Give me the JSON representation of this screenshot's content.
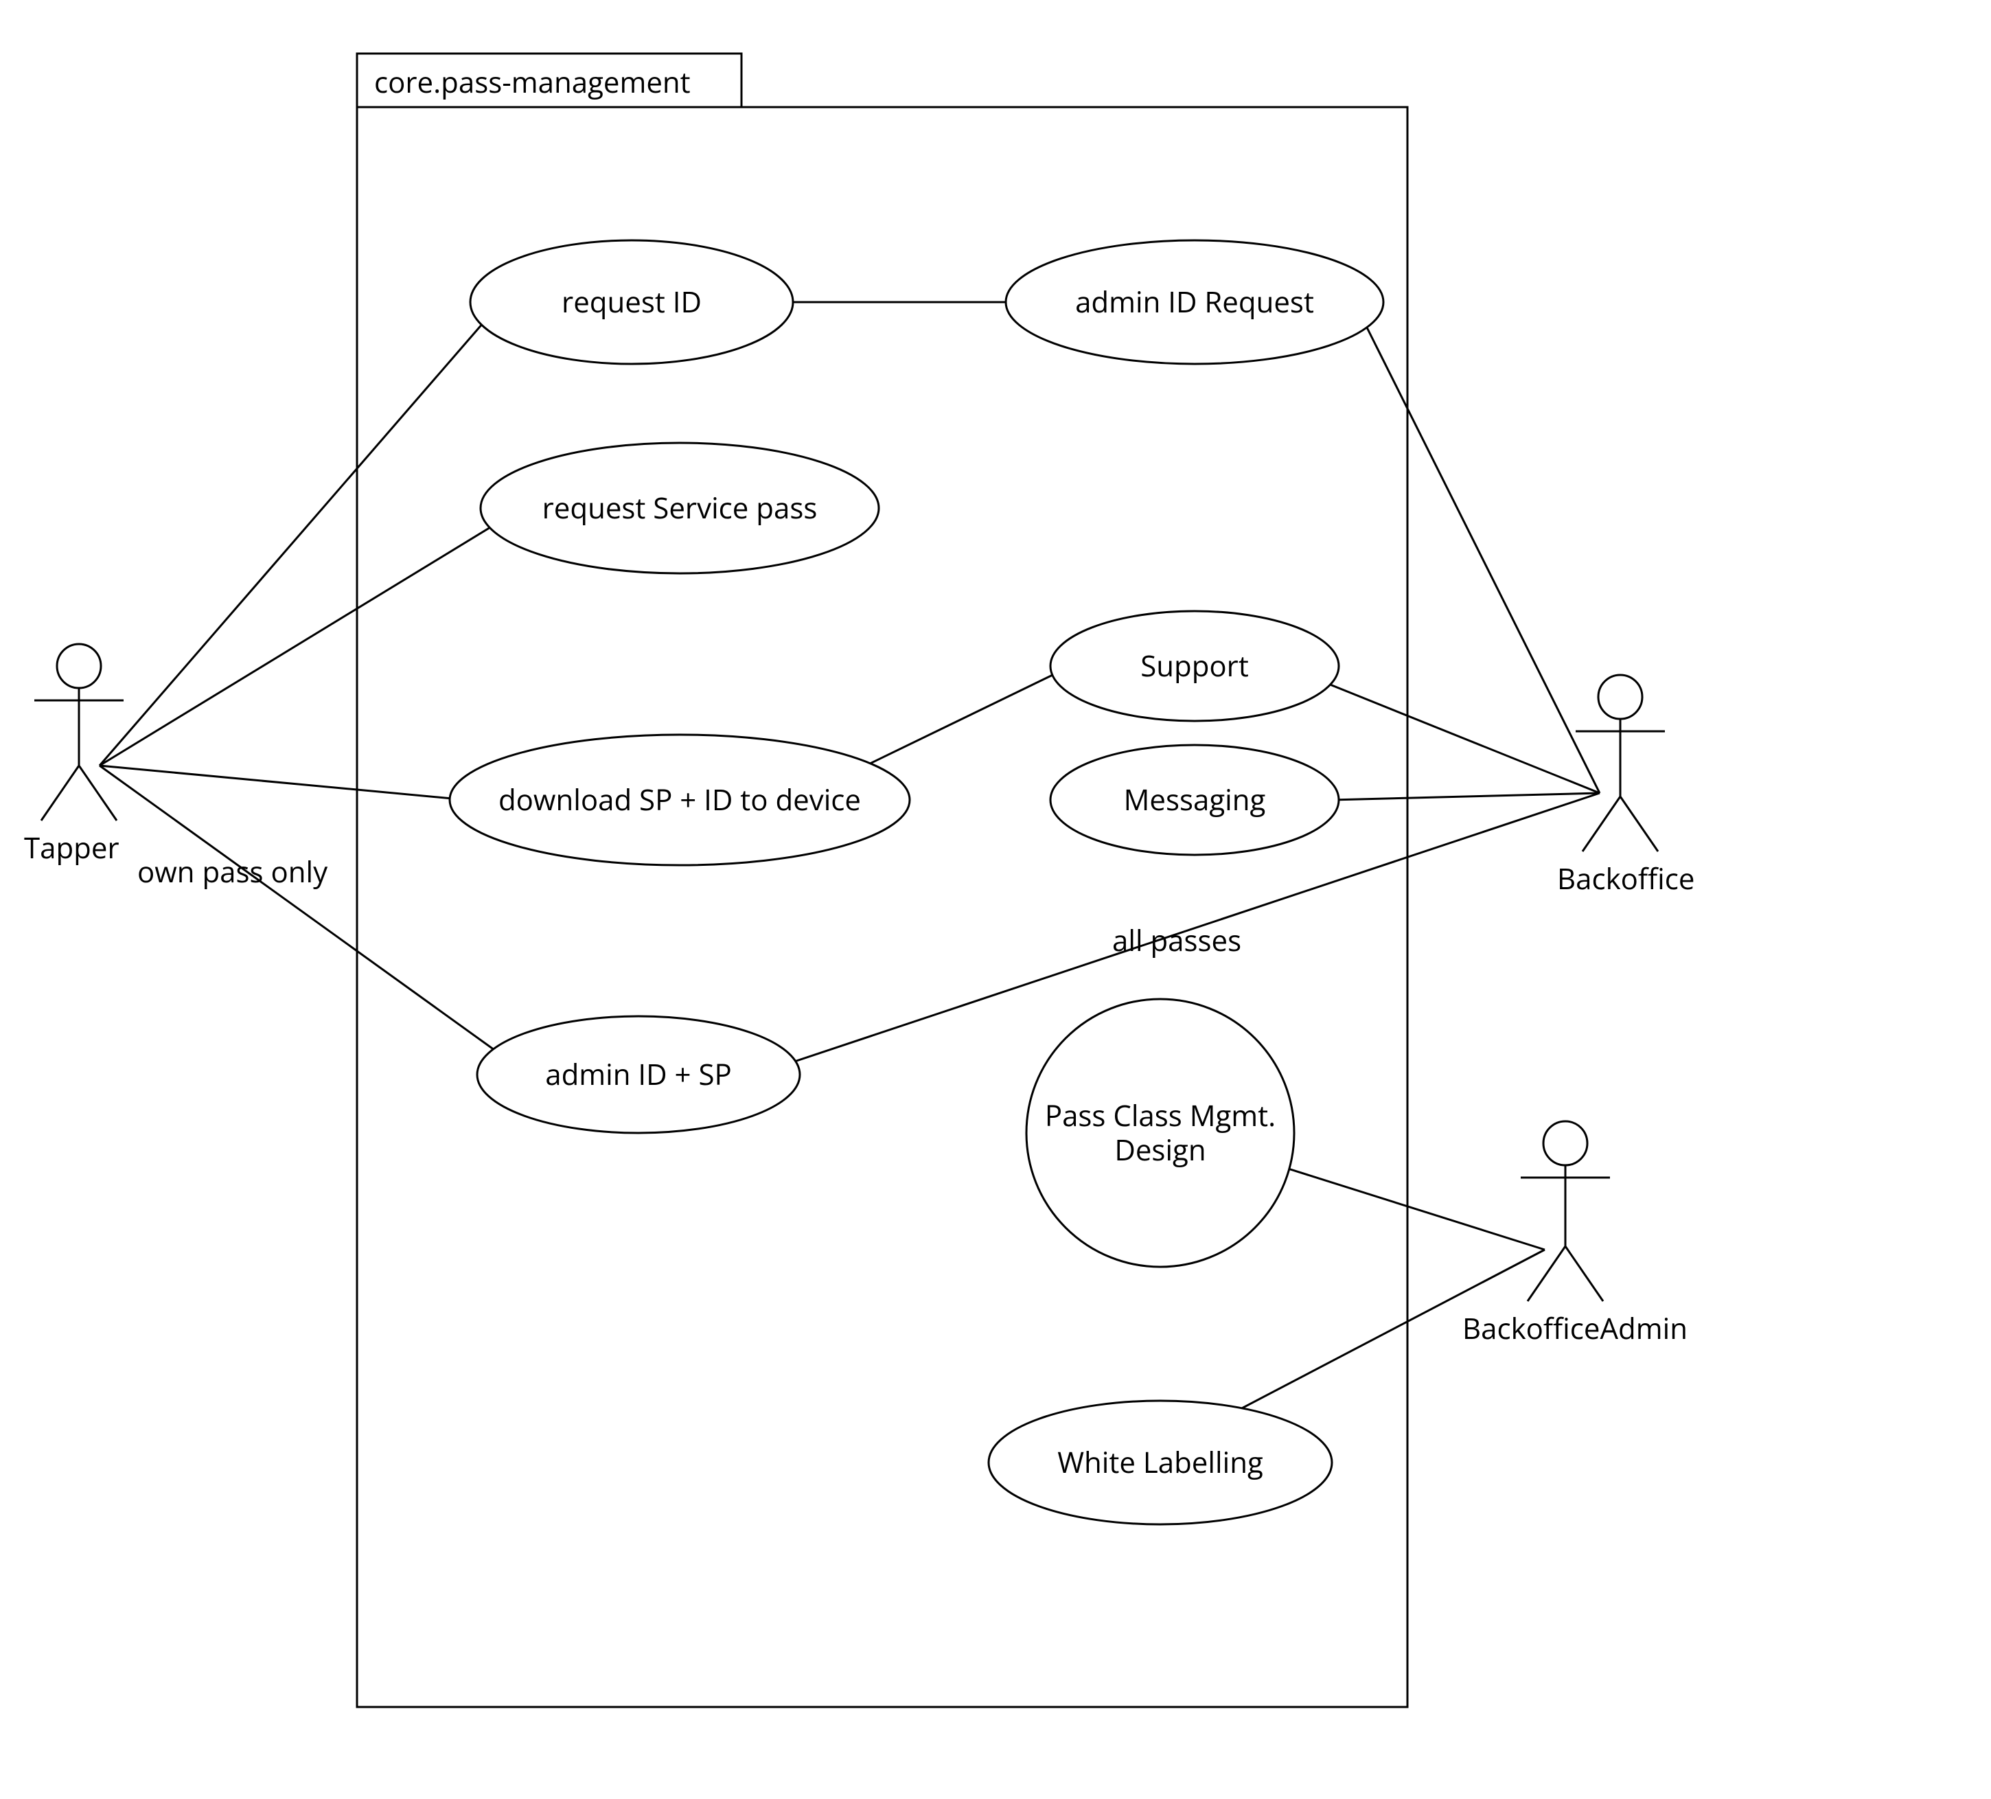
{
  "system": {
    "title": "core.pass-management"
  },
  "actors": {
    "tapper": {
      "name": "Tapper"
    },
    "backoffice": {
      "name": "Backoffice"
    },
    "backofficeAdmin": {
      "name": "BackofficeAdmin"
    }
  },
  "usecases": {
    "requestId": {
      "label": "request ID"
    },
    "adminIdReq": {
      "label": "admin ID Request"
    },
    "requestSP": {
      "label": "request Service pass"
    },
    "support": {
      "label": "Support"
    },
    "messaging": {
      "label": "Messaging"
    },
    "download": {
      "label": "download SP + ID to device"
    },
    "adminIdSp": {
      "label": "admin ID + SP"
    },
    "passClass": {
      "line1": "Pass Class Mgmt.",
      "line2": "Design"
    },
    "whiteLabel": {
      "label": "White Labelling"
    }
  },
  "assocLabels": {
    "ownPass": "own pass only",
    "allPasses": "all passes"
  }
}
